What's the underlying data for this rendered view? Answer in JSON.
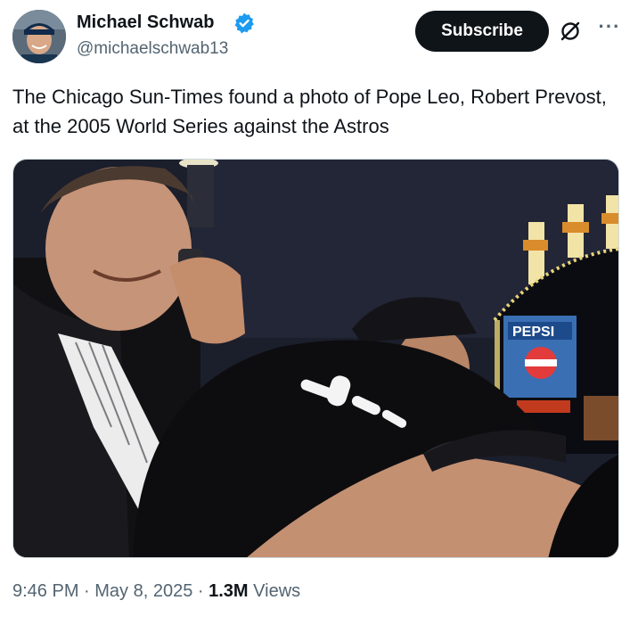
{
  "author": {
    "name": "Michael Schwab",
    "handle": "@michaelschwab13"
  },
  "actions": {
    "subscribe_label": "Subscribe",
    "more_label": "···"
  },
  "tweet": {
    "text": "The Chicago Sun-Times found a photo of Pope Leo, Robert Prevost, at the 2005 World Series against the Astros",
    "scoreboard_text": "PEPSI"
  },
  "meta": {
    "time": "9:46 PM",
    "separator": " · ",
    "date": "May 8, 2025",
    "views_count": "1.3M",
    "views_label": " Views"
  },
  "colors": {
    "verified": "#1d9bf0",
    "text": "#0f1419",
    "secondary": "#536471"
  },
  "icons": {
    "verified": "verified-badge-icon",
    "grok": "grok-icon",
    "more": "more-icon"
  }
}
